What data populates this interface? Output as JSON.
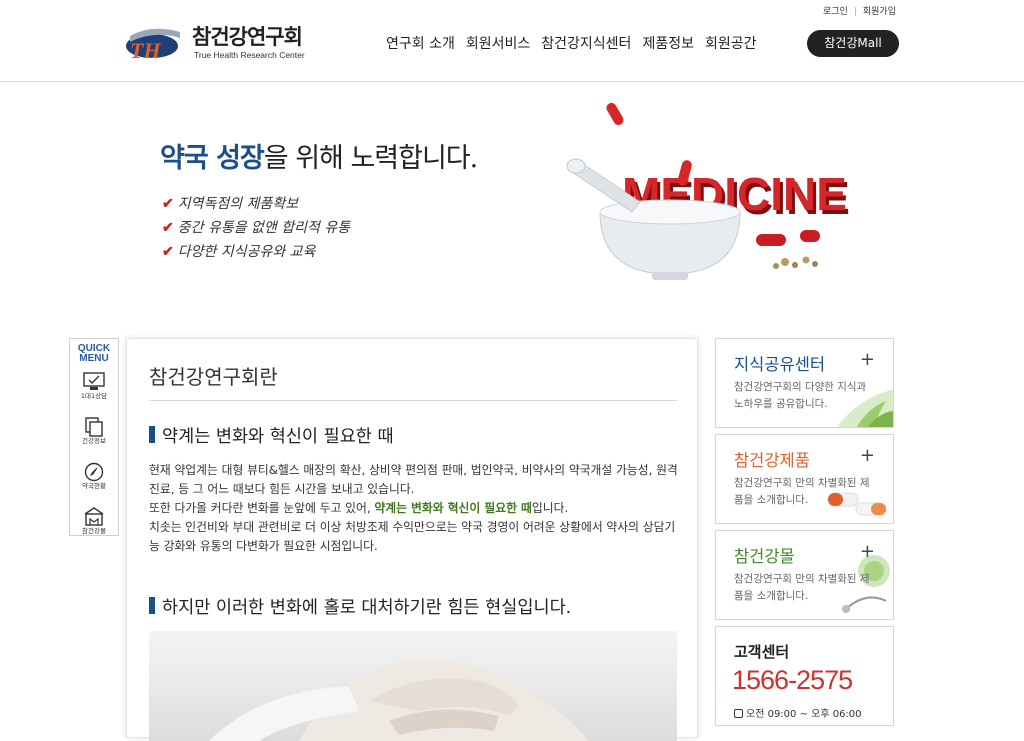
{
  "header": {
    "util_links": [
      "로그인",
      "회원가입"
    ],
    "logo": {
      "text": "TH",
      "title": "참건강연구회",
      "subtitle": "True Health Research Center"
    },
    "nav": [
      "연구회 소개",
      "회원서비스",
      "참건강지식센터",
      "제품정보",
      "회원공간"
    ],
    "mall_button": "참건강Mall"
  },
  "banner": {
    "headline_highlight": "약국 성장",
    "headline_rest": "을 위해 노력합니다.",
    "bullets": [
      "지역독점의 제품확보",
      "중간 유통을 없앤 합리적 유통",
      "다양한 지식공유와 교육"
    ],
    "art_text": "MEDICINE",
    "check_color": "#d22020",
    "highlight_color": "#1a4f8b"
  },
  "quick_menu": {
    "title_line1": "QUICK",
    "title_line2": "MENU",
    "items": [
      {
        "label": "1대1상담",
        "icon": "monitor-icon"
      },
      {
        "label": "건강정보",
        "icon": "documents-icon"
      },
      {
        "label": "약국현황",
        "icon": "compass-icon"
      },
      {
        "label": "참건강몰",
        "icon": "shop-icon"
      }
    ]
  },
  "main": {
    "title": "참건강연구회란",
    "section1_heading": "약계는 변화와 혁신이 필요한 때",
    "paragraph1": "현재 약업계는 대형 뷰티&헬스 매장의 확산, 상비약 편의점 판매, 법인약국, 비약사의 약국개설 가능성, 원격진료, 등 그 어느 때보다 힘든 시간을 보내고 있습니다.",
    "paragraph2_prefix": "또한 다가올 커다란 변화를 눈앞에 두고 있어, ",
    "paragraph2_highlight": "약계는 변화와 혁신이 필요한 때",
    "paragraph2_suffix": "입니다.",
    "paragraph3": "치솟는 인건비와 부대 관련비로 더 이상 처방조제 수익만으로는 약국 경영이 어려운 상황에서 약사의 상담기능 강화와 유통의 다변화가 필요한 시점입니다.",
    "section2_heading": "하지만 이러한 변화에 홀로 대처하기란 힘든 현실입니다.",
    "accent_color": "#1a4f8b",
    "highlight_color": "#3f7a1a"
  },
  "sidebar": {
    "knowledge": {
      "title": "지식공유센터",
      "desc": "참건강연구회의 다양한 지식과 노하우를 공유합니다.",
      "color": "#1a4f8b"
    },
    "product": {
      "title": "참건강제품",
      "desc": "참건강연구회 만의 차별화된 제품을 소개합니다.",
      "color": "#e0602a"
    },
    "mall": {
      "title": "참건강몰",
      "desc": "참건강연구회 만의 차별화된 제품을 소개합니다.",
      "color": "#3f8a2a"
    },
    "plus": "+",
    "customer": {
      "title": "고객센터",
      "phone": "1566-2575",
      "hours": "오전 09:00 ~ 오후 06:00"
    }
  }
}
